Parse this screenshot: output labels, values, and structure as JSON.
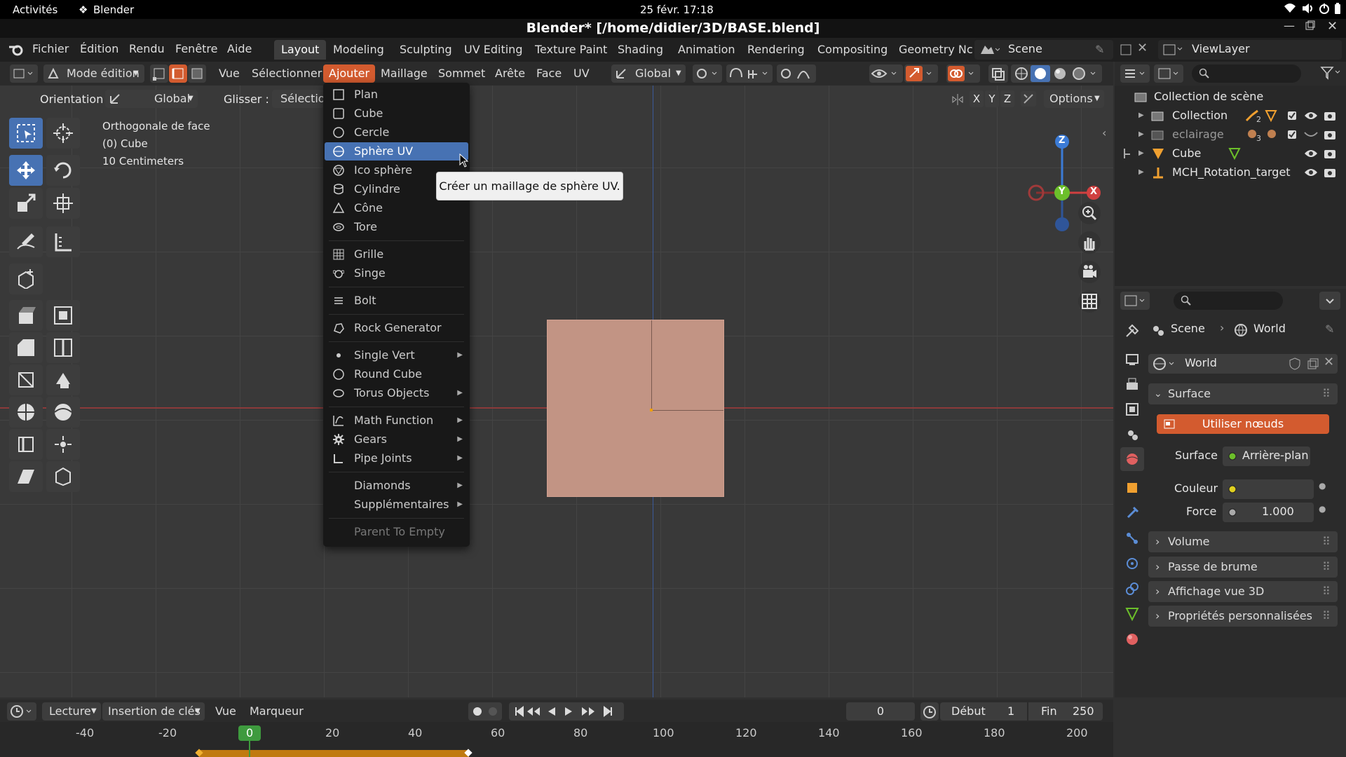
{
  "system_bar": {
    "activities": "Activités",
    "app_name": "Blender",
    "datetime": "25 févr. 17:18"
  },
  "window": {
    "title": "Blender* [/home/didier/3D/BASE.blend]"
  },
  "main_menu": [
    "Fichier",
    "Édition",
    "Rendu",
    "Fenêtre",
    "Aide"
  ],
  "workspaces": [
    "Layout",
    "Modeling",
    "Sculpting",
    "UV Editing",
    "Texture Paint",
    "Shading",
    "Animation",
    "Rendering",
    "Compositing",
    "Geometry Nc"
  ],
  "scene_selector": {
    "label": "Scene"
  },
  "viewlayer_selector": {
    "label": "ViewLayer"
  },
  "viewport_header": {
    "mode": "Mode édition",
    "menus": [
      "Vue",
      "Sélectionner",
      "Ajouter",
      "Maillage",
      "Sommet",
      "Arête",
      "Face",
      "UV"
    ],
    "transform_orientation": "Global"
  },
  "tool_settings": {
    "orientation_label": "Orientation :",
    "orientation_value": "Global",
    "drag_label": "Glisser :",
    "drag_value": "Sélection",
    "options_label": "Options"
  },
  "axis_toggles": [
    "X",
    "Y",
    "Z"
  ],
  "viewport_info": {
    "view": "Orthogonale de face",
    "object": "(0) Cube",
    "scale": "10 Centimeters"
  },
  "add_menu": {
    "items": [
      {
        "label": "Plan"
      },
      {
        "label": "Cube"
      },
      {
        "label": "Cercle"
      },
      {
        "label": "Sphère UV"
      },
      {
        "label": "Ico sphère"
      },
      {
        "label": "Cylindre"
      },
      {
        "label": "Cône"
      },
      {
        "label": "Tore"
      },
      {
        "label": "Grille"
      },
      {
        "label": "Singe"
      },
      {
        "label": "Bolt"
      },
      {
        "label": "Rock Generator"
      },
      {
        "label": "Single Vert"
      },
      {
        "label": "Round Cube"
      },
      {
        "label": "Torus Objects"
      },
      {
        "label": "Math Function"
      },
      {
        "label": "Gears"
      },
      {
        "label": "Pipe Joints"
      },
      {
        "label": "Diamonds"
      },
      {
        "label": "Supplémentaires"
      },
      {
        "label": "Parent To Empty"
      }
    ],
    "highlighted": "Sphère UV"
  },
  "tooltip": {
    "text": "Créer un maillage de sphère UV."
  },
  "gizmo": {
    "z": "Z",
    "y": "Y",
    "x": "X"
  },
  "outliner": {
    "root": "Collection de scène",
    "items": [
      "Collection",
      "eclairage",
      "Cube",
      "MCH_Rotation_target"
    ],
    "badges": {
      "collection": "2",
      "eclairage": "3"
    }
  },
  "properties": {
    "breadcrumb": [
      "Scene",
      "World"
    ],
    "world_name": "World",
    "surface_panel": "Surface",
    "use_nodes_button": "Utiliser nœuds",
    "surface_label": "Surface",
    "surface_value": "Arrière-plan",
    "color_label": "Couleur",
    "strength_label": "Force",
    "strength_value": "1.000",
    "panels": [
      "Volume",
      "Passe de brume",
      "Affichage vue 3D",
      "Propriétés personnalisées"
    ]
  },
  "timeline": {
    "menus": [
      "Lecture",
      "Insertion de clés",
      "Vue",
      "Marqueur"
    ],
    "current_frame": "0",
    "start_label": "Début",
    "start_value": "1",
    "end_label": "Fin",
    "end_value": "250",
    "ticks": [
      "-40",
      "-20",
      "0",
      "20",
      "40",
      "60",
      "80",
      "100",
      "120",
      "140",
      "160",
      "180",
      "200"
    ]
  },
  "colors": {
    "accent": "#4772b3",
    "highlight_orange": "#d35b2f",
    "mesh_face": "#c29484",
    "frame_green": "#3e9a3e"
  }
}
